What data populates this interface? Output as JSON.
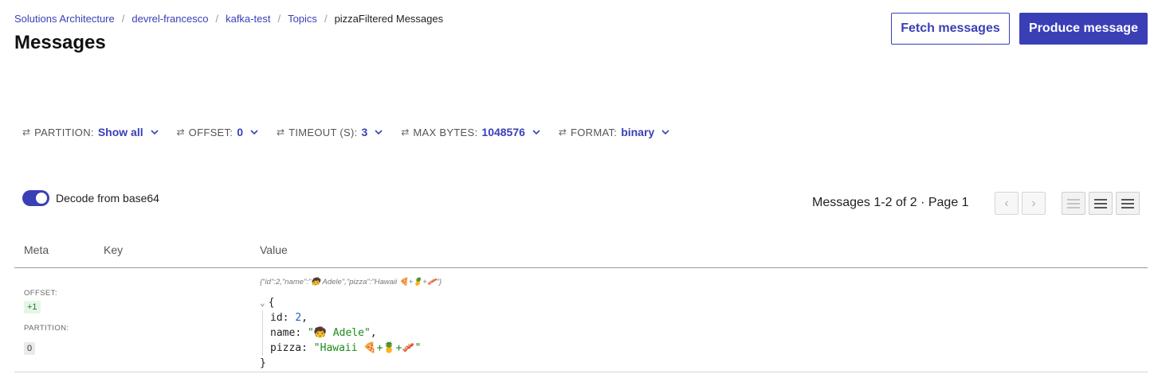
{
  "breadcrumb": {
    "items": [
      "Solutions Architecture",
      "devrel-francesco",
      "kafka-test",
      "Topics"
    ],
    "current": "pizzaFiltered Messages",
    "separator": "/"
  },
  "page_title": "Messages",
  "actions": {
    "fetch_label": "Fetch messages",
    "produce_label": "Produce message"
  },
  "filters": [
    {
      "label": "PARTITION:",
      "value": "Show all"
    },
    {
      "label": "OFFSET:",
      "value": "0"
    },
    {
      "label": "TIMEOUT (S):",
      "value": "3"
    },
    {
      "label": "MAX BYTES:",
      "value": "1048576"
    },
    {
      "label": "FORMAT:",
      "value": "binary"
    }
  ],
  "decode": {
    "label": "Decode from base64",
    "enabled": true
  },
  "pagination": {
    "text": "Messages 1-2 of 2 · Page 1",
    "prev_icon": "‹",
    "next_icon": "›"
  },
  "table": {
    "headers": {
      "meta": "Meta",
      "key": "Key",
      "value": "Value"
    },
    "rows": [
      {
        "offset_label": "OFFSET:",
        "offset": "+1",
        "partition_label": "PARTITION:",
        "partition": "0",
        "key": "",
        "raw": "{\"id\":2,\"name\":\"🧒 Adele\",\"pizza\":\"Hawaii 🍕+🍍+🥓\"}",
        "json": {
          "open": "{",
          "close": "}",
          "id_key": "id",
          "id_value": "2",
          "name_key": "name",
          "name_value": "\"🧒 Adele\"",
          "pizza_key": "pizza",
          "pizza_value": "\"Hawaii 🍕+🍍+🥓\""
        }
      }
    ]
  },
  "colors": {
    "accent": "#3a3fb6",
    "string": "#1c8a1c",
    "number": "#1f5fbf"
  },
  "icons": {
    "filter": "filter-icon",
    "chevron": "chevron-down-icon"
  }
}
